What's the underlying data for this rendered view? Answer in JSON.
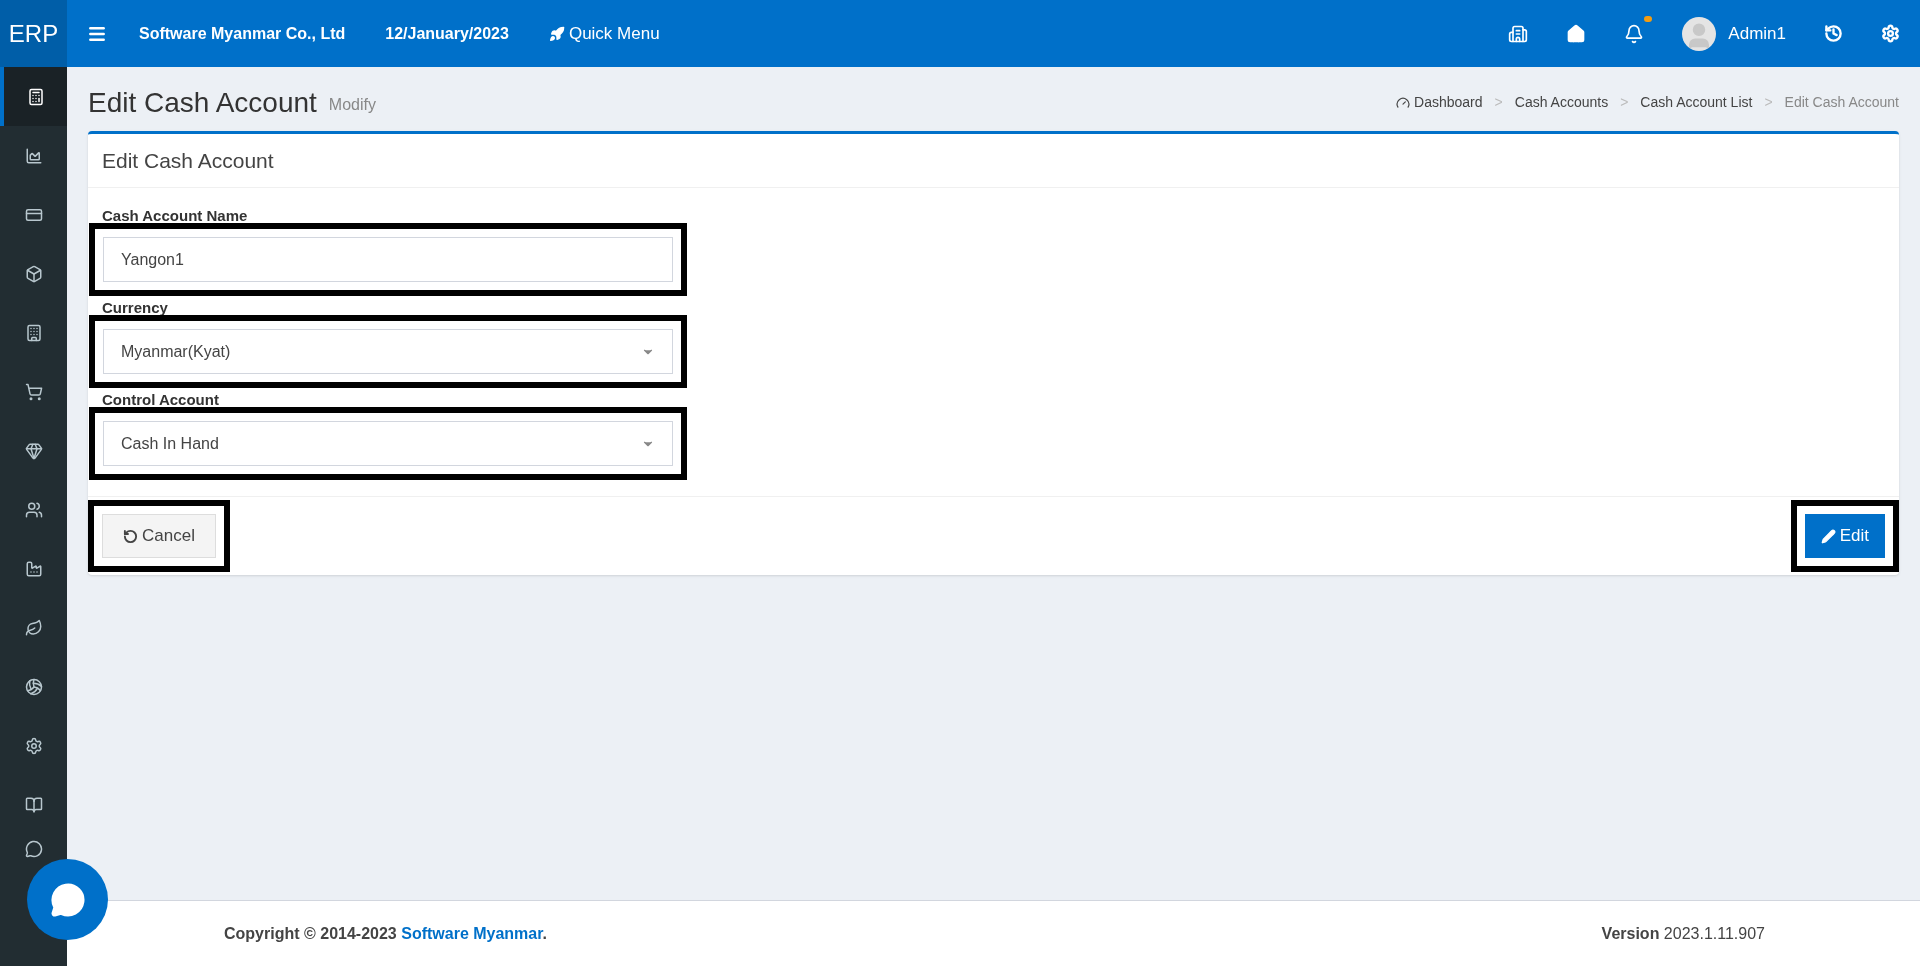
{
  "topbar": {
    "logo": "ERP",
    "company": "Software Myanmar Co., Ltd",
    "date": "12/January/2023",
    "quick_menu": "Quick Menu",
    "notification_unread": true,
    "user": "Admin1"
  },
  "sidebar": {
    "items": [
      {
        "selected": true
      },
      {
        "selected": false
      },
      {
        "selected": false
      },
      {
        "selected": false
      },
      {
        "selected": false
      },
      {
        "selected": false
      },
      {
        "selected": false
      },
      {
        "selected": false
      },
      {
        "selected": false
      },
      {
        "selected": false
      },
      {
        "selected": false
      },
      {
        "selected": false
      },
      {
        "selected": false
      },
      {
        "selected": false
      }
    ]
  },
  "page": {
    "title": "Edit Cash Account",
    "subtitle": "Modify"
  },
  "breadcrumb": [
    {
      "label": "Dashboard",
      "current": false
    },
    {
      "separator": ">",
      "label": "Cash Accounts",
      "current": false
    },
    {
      "separator": ">",
      "label": "Cash Account List",
      "current": false
    },
    {
      "separator": ">",
      "label": "Edit Cash Account",
      "current": true
    }
  ],
  "form": {
    "title": "Edit Cash Account",
    "fields": [
      {
        "kind": "text",
        "label": "Cash Account Name",
        "value": "Yangon1",
        "highlighted": true
      },
      {
        "kind": "select",
        "label": "Currency",
        "value": "Myanmar(Kyat)",
        "highlighted": true
      },
      {
        "kind": "select",
        "label": "Control Account",
        "value": "Cash In Hand",
        "highlighted": true
      }
    ],
    "cancel": {
      "label": "Cancel",
      "highlighted": true
    },
    "edit": {
      "label": "Edit",
      "highlighted": true
    }
  },
  "footer": {
    "copyright": "Copyright © 2014-2023",
    "company_link": "Software Myanmar",
    "period": ".",
    "version_label": "Version",
    "version": "2023.1.11.907"
  }
}
